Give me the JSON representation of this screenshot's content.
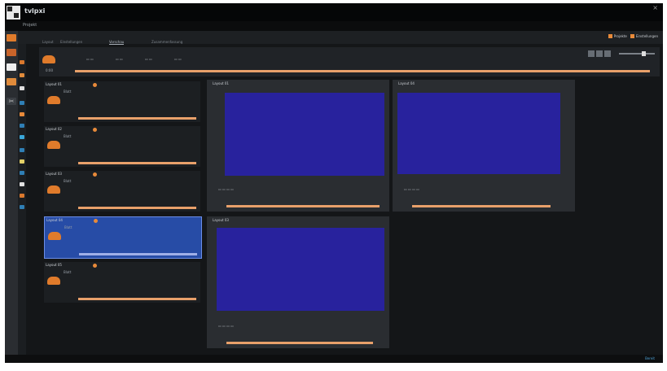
{
  "app": {
    "title": "tvlpxi",
    "menu": "Projekt",
    "close_glyph": "×"
  },
  "tabs": [
    "Layout",
    "Einstellungen",
    "Vorschau",
    "Zusammenfassung"
  ],
  "filters": [
    {
      "label": "Projekte",
      "color": "#e88a3a"
    },
    {
      "label": "Einstellungen",
      "color": "#e88a3a"
    }
  ],
  "toolbar": {
    "progress_label": "0:00"
  },
  "items": [
    {
      "title": "Layout 01",
      "subtitle": "Blatt"
    },
    {
      "title": "Layout 02",
      "subtitle": "Blatt"
    },
    {
      "title": "Layout 03",
      "subtitle": "Blatt"
    },
    {
      "title": "Layout 04",
      "subtitle": "Blatt"
    },
    {
      "title": "Layout 05",
      "subtitle": "Blatt"
    }
  ],
  "previews": [
    {
      "title": "Layout 01"
    },
    {
      "title": "Layout 04"
    },
    {
      "title": "Layout 03"
    }
  ],
  "status": {
    "text": "Bereit"
  },
  "colors": {
    "accent": "#e8a06a",
    "selection": "#274ca6",
    "canvas": "#28229d"
  }
}
